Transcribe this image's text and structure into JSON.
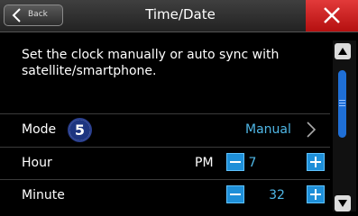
{
  "header": {
    "back_label": "Back",
    "title": "Time/Date"
  },
  "description": "Set the clock manually or auto sync with satellite/smartphone.",
  "rows": {
    "mode": {
      "label": "Mode",
      "badge": "5",
      "value": "Manual"
    },
    "hour": {
      "label": "Hour",
      "ampm": "PM",
      "value": "7"
    },
    "minute": {
      "label": "Minute",
      "value": "32"
    }
  },
  "colors": {
    "accent": "#4fb7e6",
    "stepper": "#1e8fd8",
    "close": "#d42222",
    "scroll": "#1f6fd6"
  },
  "icons": {
    "back": "chevron-left-icon",
    "close": "close-icon",
    "mode_open": "chevron-right-icon",
    "scroll_up": "triangle-up-icon",
    "scroll_down": "triangle-down-icon"
  }
}
